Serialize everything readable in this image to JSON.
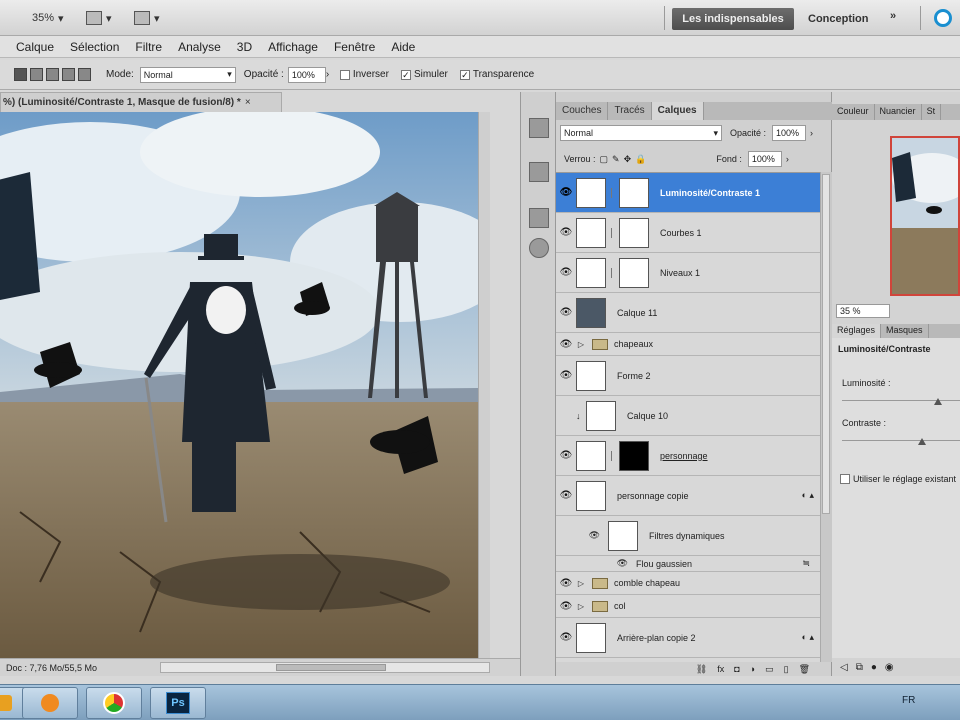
{
  "titlebar": {
    "zoom_value": "35%",
    "workspace_active": "Les indispensables",
    "workspace_other": "Conception",
    "more": "»"
  },
  "menu": [
    "Calque",
    "Sélection",
    "Filtre",
    "Analyse",
    "3D",
    "Affichage",
    "Fenêtre",
    "Aide"
  ],
  "options": {
    "mode_label": "Mode:",
    "mode_value": "Normal",
    "opacity_label": "Opacité :",
    "opacity_value": "100%",
    "invert_label": "Inverser",
    "simulate_label": "Simuler",
    "transparency_label": "Transparence"
  },
  "document": {
    "tab_title": "%) (Luminosité/Contraste 1, Masque de fusion/8) *",
    "close": "×",
    "status": "Doc : 7,76 Mo/55,5 Mo"
  },
  "panel_tabs": [
    "Couches",
    "Tracés",
    "Calques"
  ],
  "layers_panel": {
    "blend_mode": "Normal",
    "opacity_label": "Opacité :",
    "opacity_value": "100%",
    "lock_label": "Verrou :",
    "fill_label": "Fond :",
    "fill_value": "100%"
  },
  "layers": [
    {
      "name": "Luminosité/Contraste 1",
      "type": "adjustment",
      "selected": true
    },
    {
      "name": "Courbes 1",
      "type": "adjustment",
      "selected": false
    },
    {
      "name": "Niveaux 1",
      "type": "adjustment",
      "selected": false
    },
    {
      "name": "Calque 11",
      "type": "pixel",
      "selected": false
    },
    {
      "name": "chapeaux",
      "type": "group",
      "selected": false
    },
    {
      "name": "Forme 2",
      "type": "pixel",
      "selected": false
    },
    {
      "name": "Calque 10",
      "type": "pixel",
      "selected": false
    },
    {
      "name": "personnage",
      "type": "masked",
      "selected": false
    },
    {
      "name": "personnage copie",
      "type": "smart",
      "selected": false
    },
    {
      "name": "Filtres dynamiques",
      "type": "filter",
      "selected": false
    },
    {
      "name": "Flou gaussien",
      "type": "filter-item",
      "selected": false
    },
    {
      "name": "comble chapeau",
      "type": "group",
      "selected": false
    },
    {
      "name": "col",
      "type": "group",
      "selected": false
    },
    {
      "name": "Arrière-plan copie 2",
      "type": "smart",
      "selected": false
    }
  ],
  "right_tabs": [
    "Couleur",
    "Nuancier",
    "St"
  ],
  "navigator": {
    "zoom": "35 %"
  },
  "adjust_tabs": [
    "Réglages",
    "Masques"
  ],
  "adjustments": {
    "title": "Luminosité/Contraste",
    "brightness_label": "Luminosité :",
    "contrast_label": "Contraste :",
    "legacy_label": "Utiliser le réglage existant"
  },
  "taskbar": {
    "lang": "FR",
    "ps_label": "Ps"
  },
  "colors": {
    "selection": "#3c7fd6",
    "workspace_active": "#5a5a5a",
    "nav_border": "#d0443a"
  }
}
